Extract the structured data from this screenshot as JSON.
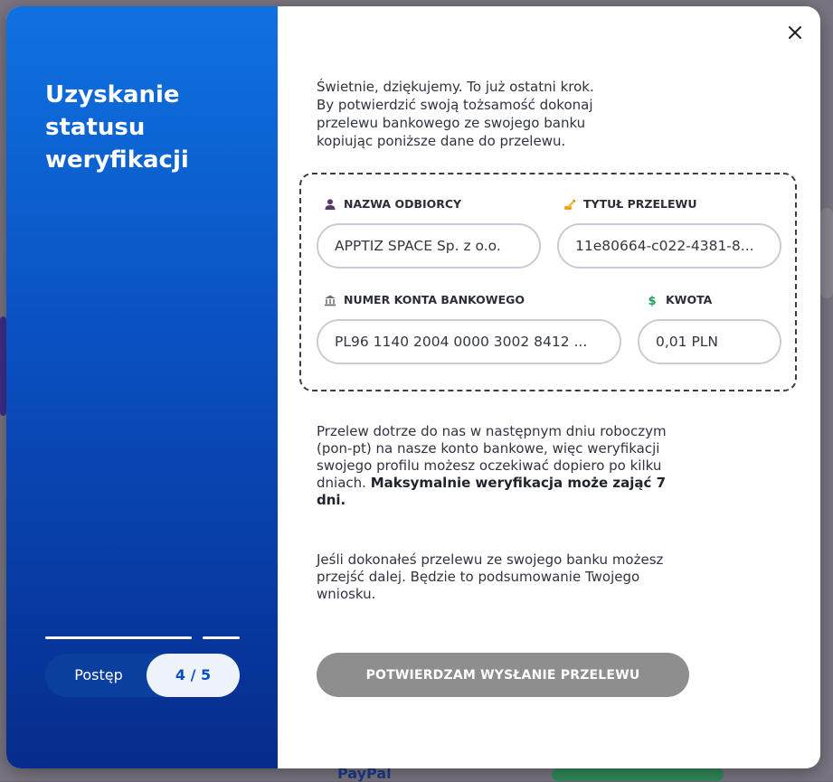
{
  "sidebar": {
    "title": "Uzyskanie statusu weryfikacji",
    "progress_label": "Postęp",
    "progress_step": "4 / 5",
    "progress_value": 0.8
  },
  "intro": {
    "line1": "Świetnie, dziękujemy. To już ostatni krok.",
    "line2": "By potwierdzić swoją tożsamość dokonaj przelewu bankowego ze swojego banku kopiując poniższe dane do przelewu."
  },
  "transfer": {
    "recipient_label": "NAZWA ODBIORCY",
    "recipient_value": "APPTIZ SPACE Sp. z o.o.",
    "title_label": "TYTUŁ PRZELEWU",
    "title_value": "11e80664-c022-4381-8...",
    "account_label": "NUMER KONTA BANKOWEGO",
    "account_value": "PL96 1140 2004 0000 3002 8412 ...",
    "amount_label": "KWOTA",
    "amount_value": "0,01 PLN"
  },
  "info": {
    "text": "Przelew dotrze do nas w następnym dniu roboczym (pon-pt) na nasze konto bankowe, więc weryfikacji swojego profilu możesz oczekiwać dopiero po kilku dniach.",
    "bold": "Maksymalnie weryfikacja może zająć 7 dni.",
    "followup": "Jeśli dokonałeś przelewu ze swojego banku możesz przejść dalej. Będzie to podsumowanie Twojego wniosku."
  },
  "actions": {
    "confirm_label": "POTWIERDZAM WYSŁANIE PRZELEWU"
  },
  "background": {
    "paypal": "PayPal"
  },
  "colors": {
    "accent": "#0a4fc0",
    "sidebar_top": "#0f72e0",
    "sidebar_bottom": "#062c8c",
    "button_disabled": "#8e8e8e"
  }
}
